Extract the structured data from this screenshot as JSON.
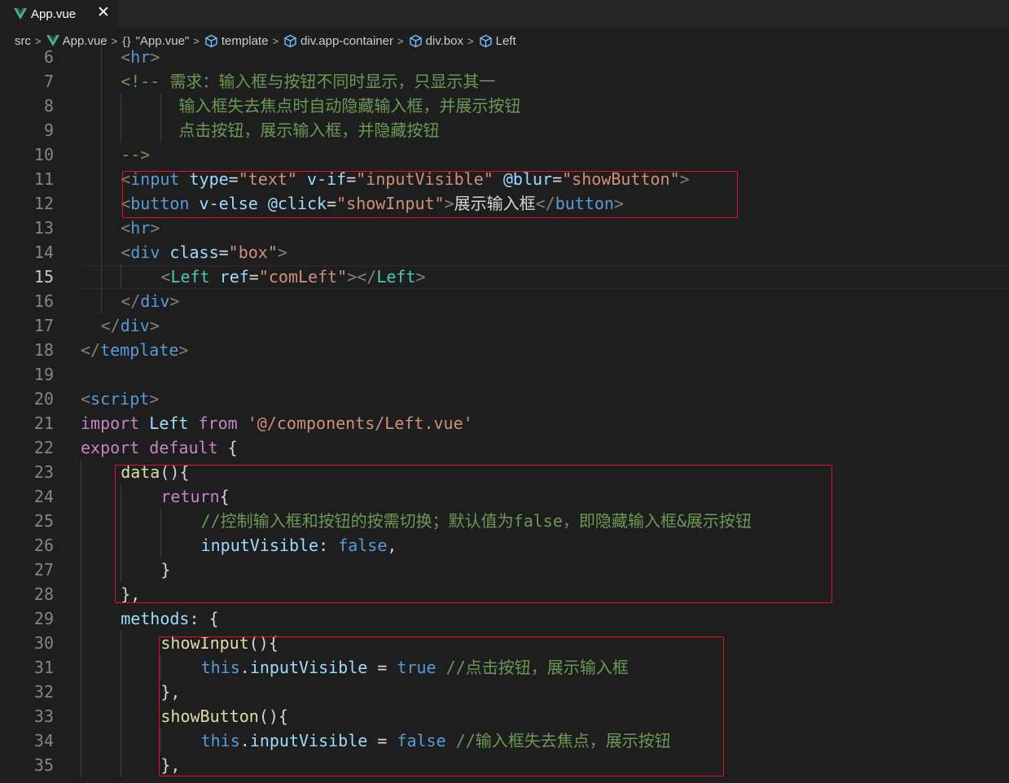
{
  "tab": {
    "filename": "App.vue",
    "close_symbol": "✕",
    "vue_green": "#41b883",
    "vue_dark": "#35495e"
  },
  "breadcrumb": {
    "items": [
      {
        "label": "src",
        "icon": ""
      },
      {
        "label": "App.vue",
        "icon": "vue-icon"
      },
      {
        "label": "\"App.vue\"",
        "icon": "braces-icon"
      },
      {
        "label": "template",
        "icon": "cube-icon"
      },
      {
        "label": "div.app-container",
        "icon": "cube-icon"
      },
      {
        "label": "div.box",
        "icon": "cube-icon"
      },
      {
        "label": "Left",
        "icon": "cube-icon"
      }
    ],
    "separator": ">"
  },
  "editor": {
    "active_line": 15,
    "highlight_color": "#e81123",
    "line_numbers": [
      "6",
      "7",
      "8",
      "9",
      "10",
      "11",
      "12",
      "13",
      "14",
      "15",
      "16",
      "17",
      "18",
      "19",
      "20",
      "21",
      "22",
      "23",
      "24",
      "25",
      "26",
      "27",
      "28",
      "29",
      "30",
      "31",
      "32",
      "33",
      "34",
      "35"
    ],
    "lines": [
      [
        [
          "punc",
          "<"
        ],
        [
          "kw-tag",
          "hr"
        ],
        [
          "punc",
          ">"
        ]
      ],
      [
        [
          "comment",
          "<!-- 需求：输入框与按钮不同时显示，只显示其一"
        ]
      ],
      [
        [
          "comment",
          "          输入框失去焦点时自动隐藏输入框，并展示按钮"
        ]
      ],
      [
        [
          "comment",
          "          点击按钮，展示输入框，并隐藏按钮"
        ]
      ],
      [
        [
          "comment",
          "-->"
        ]
      ],
      [
        [
          "punc",
          "<"
        ],
        [
          "kw-tag",
          "input"
        ],
        [
          "plain",
          " "
        ],
        [
          "attr",
          "type"
        ],
        [
          "plain",
          "="
        ],
        [
          "str",
          "\"text\""
        ],
        [
          "plain",
          " "
        ],
        [
          "attr",
          "v-if"
        ],
        [
          "plain",
          "="
        ],
        [
          "str",
          "\"inputVisible\""
        ],
        [
          "plain",
          " "
        ],
        [
          "attr",
          "@blur"
        ],
        [
          "plain",
          "="
        ],
        [
          "str",
          "\"showButton\""
        ],
        [
          "punc",
          ">"
        ]
      ],
      [
        [
          "punc",
          "<"
        ],
        [
          "kw-tag",
          "button"
        ],
        [
          "plain",
          " "
        ],
        [
          "attr",
          "v-else"
        ],
        [
          "plain",
          " "
        ],
        [
          "attr",
          "@click"
        ],
        [
          "plain",
          "="
        ],
        [
          "str",
          "\"showInput\""
        ],
        [
          "punc",
          ">"
        ],
        [
          "text",
          "展示输入框"
        ],
        [
          "punc",
          "</"
        ],
        [
          "kw-tag",
          "button"
        ],
        [
          "punc",
          ">"
        ]
      ],
      [
        [
          "punc",
          "<"
        ],
        [
          "kw-tag",
          "hr"
        ],
        [
          "punc",
          ">"
        ]
      ],
      [
        [
          "punc",
          "<"
        ],
        [
          "kw-tag",
          "div"
        ],
        [
          "plain",
          " "
        ],
        [
          "attr",
          "class"
        ],
        [
          "plain",
          "="
        ],
        [
          "str",
          "\"box\""
        ],
        [
          "punc",
          ">"
        ]
      ],
      [
        [
          "punc",
          "<"
        ],
        [
          "comp-tag",
          "Left"
        ],
        [
          "plain",
          " "
        ],
        [
          "attr",
          "ref"
        ],
        [
          "plain",
          "="
        ],
        [
          "str",
          "\"comLeft\""
        ],
        [
          "punc",
          "></"
        ],
        [
          "comp-tag",
          "Left"
        ],
        [
          "punc",
          ">"
        ]
      ],
      [
        [
          "punc",
          "</"
        ],
        [
          "kw-tag",
          "div"
        ],
        [
          "punc",
          ">"
        ]
      ],
      [
        [
          "punc",
          "</"
        ],
        [
          "kw-tag",
          "div"
        ],
        [
          "punc",
          ">"
        ]
      ],
      [
        [
          "punc",
          "</"
        ],
        [
          "kw-tag",
          "template"
        ],
        [
          "punc",
          ">"
        ]
      ],
      [],
      [
        [
          "punc",
          "<"
        ],
        [
          "kw-tag",
          "script"
        ],
        [
          "punc",
          ">"
        ]
      ],
      [
        [
          "import-kw",
          "import"
        ],
        [
          "plain",
          " "
        ],
        [
          "prop",
          "Left"
        ],
        [
          "plain",
          " "
        ],
        [
          "import-kw",
          "from"
        ],
        [
          "plain",
          " "
        ],
        [
          "str",
          "'@/components/Left.vue'"
        ]
      ],
      [
        [
          "import-kw",
          "export"
        ],
        [
          "plain",
          " "
        ],
        [
          "import-kw",
          "default"
        ],
        [
          "plain",
          " {"
        ]
      ],
      [
        [
          "fn",
          "data"
        ],
        [
          "plain",
          "(){"
        ]
      ],
      [
        [
          "import-kw",
          "return"
        ],
        [
          "plain",
          "{"
        ]
      ],
      [
        [
          "comment",
          "//控制输入框和按钮的按需切换；默认值为false，即隐藏输入框&展示按钮"
        ]
      ],
      [
        [
          "prop",
          "inputVisible"
        ],
        [
          "plain",
          ": "
        ],
        [
          "bool",
          "false"
        ],
        [
          "plain",
          ","
        ]
      ],
      [
        [
          "plain",
          "}"
        ]
      ],
      [
        [
          "plain",
          "},"
        ]
      ],
      [
        [
          "prop",
          "methods"
        ],
        [
          "plain",
          ": {"
        ]
      ],
      [
        [
          "fn",
          "showInput"
        ],
        [
          "plain",
          "(){"
        ]
      ],
      [
        [
          "this-kw",
          "this"
        ],
        [
          "plain",
          "."
        ],
        [
          "prop",
          "inputVisible"
        ],
        [
          "plain",
          " = "
        ],
        [
          "bool",
          "true"
        ],
        [
          "plain",
          " "
        ],
        [
          "comment",
          "//点击按钮，展示输入框"
        ]
      ],
      [
        [
          "plain",
          "},"
        ]
      ],
      [
        [
          "fn",
          "showButton"
        ],
        [
          "plain",
          "(){"
        ]
      ],
      [
        [
          "this-kw",
          "this"
        ],
        [
          "plain",
          "."
        ],
        [
          "prop",
          "inputVisible"
        ],
        [
          "plain",
          " = "
        ],
        [
          "bool",
          "false"
        ],
        [
          "plain",
          " "
        ],
        [
          "comment",
          "//输入框失去焦点，展示按钮"
        ]
      ],
      [
        [
          "plain",
          "},"
        ]
      ]
    ]
  }
}
